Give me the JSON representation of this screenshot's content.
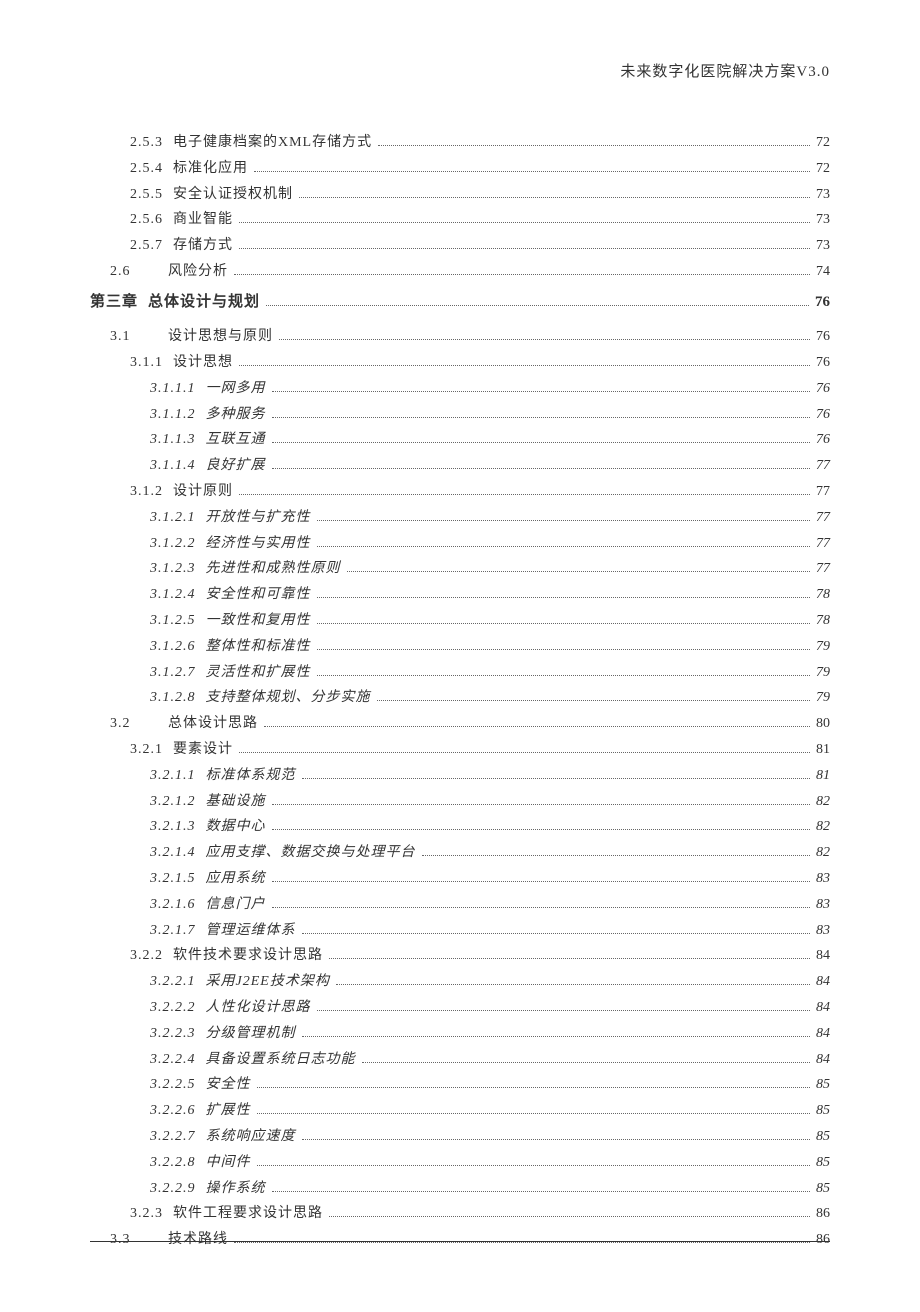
{
  "header": "未来数字化医院解决方案V3.0",
  "entries": [
    {
      "num": "2.5.3",
      "text": "电子健康档案的XML存储方式",
      "page": "72",
      "indent": 2
    },
    {
      "num": "2.5.4",
      "text": "标准化应用",
      "page": "72",
      "indent": 2
    },
    {
      "num": "2.5.5",
      "text": "安全认证授权机制",
      "page": "73",
      "indent": 2
    },
    {
      "num": "2.5.6",
      "text": "商业智能",
      "page": "73",
      "indent": 2
    },
    {
      "num": "2.5.7",
      "text": "存储方式",
      "page": "73",
      "indent": 2
    },
    {
      "num": "2.6",
      "text": "风险分析",
      "page": "74",
      "indent": 1,
      "wide": true
    },
    {
      "num": "第三章",
      "text": "总体设计与规划",
      "page": "76",
      "indent": 0,
      "chapter": true
    },
    {
      "num": "3.1",
      "text": "设计思想与原则",
      "page": "76",
      "indent": 1,
      "wide": true
    },
    {
      "num": "3.1.1",
      "text": "设计思想",
      "page": "76",
      "indent": 2
    },
    {
      "num": "3.1.1.1",
      "text": "一网多用",
      "page": "76",
      "indent": 3
    },
    {
      "num": "3.1.1.2",
      "text": "多种服务",
      "page": "76",
      "indent": 3
    },
    {
      "num": "3.1.1.3",
      "text": "互联互通",
      "page": "76",
      "indent": 3
    },
    {
      "num": "3.1.1.4",
      "text": "良好扩展",
      "page": "77",
      "indent": 3
    },
    {
      "num": "3.1.2",
      "text": "设计原则",
      "page": "77",
      "indent": 2
    },
    {
      "num": "3.1.2.1",
      "text": "开放性与扩充性",
      "page": "77",
      "indent": 3
    },
    {
      "num": "3.1.2.2",
      "text": "经济性与实用性",
      "page": "77",
      "indent": 3
    },
    {
      "num": "3.1.2.3",
      "text": "先进性和成熟性原则",
      "page": "77",
      "indent": 3
    },
    {
      "num": "3.1.2.4",
      "text": "安全性和可靠性",
      "page": "78",
      "indent": 3
    },
    {
      "num": "3.1.2.5",
      "text": "一致性和复用性",
      "page": "78",
      "indent": 3
    },
    {
      "num": "3.1.2.6",
      "text": "整体性和标准性",
      "page": "79",
      "indent": 3
    },
    {
      "num": "3.1.2.7",
      "text": "灵活性和扩展性",
      "page": "79",
      "indent": 3
    },
    {
      "num": "3.1.2.8",
      "text": "支持整体规划、分步实施",
      "page": "79",
      "indent": 3
    },
    {
      "num": "3.2",
      "text": "总体设计思路",
      "page": "80",
      "indent": 1,
      "wide": true
    },
    {
      "num": "3.2.1",
      "text": "要素设计",
      "page": "81",
      "indent": 2
    },
    {
      "num": "3.2.1.1",
      "text": "标准体系规范",
      "page": "81",
      "indent": 3
    },
    {
      "num": "3.2.1.2",
      "text": "基础设施",
      "page": "82",
      "indent": 3
    },
    {
      "num": "3.2.1.3",
      "text": "数据中心",
      "page": "82",
      "indent": 3
    },
    {
      "num": "3.2.1.4",
      "text": "应用支撑、数据交换与处理平台",
      "page": "82",
      "indent": 3
    },
    {
      "num": "3.2.1.5",
      "text": "应用系统",
      "page": "83",
      "indent": 3
    },
    {
      "num": "3.2.1.6",
      "text": "信息门户",
      "page": "83",
      "indent": 3
    },
    {
      "num": "3.2.1.7",
      "text": "管理运维体系",
      "page": "83",
      "indent": 3
    },
    {
      "num": "3.2.2",
      "text": "软件技术要求设计思路",
      "page": "84",
      "indent": 2
    },
    {
      "num": "3.2.2.1",
      "text": "采用J2EE技术架构",
      "page": "84",
      "indent": 3
    },
    {
      "num": "3.2.2.2",
      "text": "人性化设计思路",
      "page": "84",
      "indent": 3
    },
    {
      "num": "3.2.2.3",
      "text": "分级管理机制",
      "page": "84",
      "indent": 3
    },
    {
      "num": "3.2.2.4",
      "text": "具备设置系统日志功能",
      "page": "84",
      "indent": 3
    },
    {
      "num": "3.2.2.5",
      "text": "安全性",
      "page": "85",
      "indent": 3
    },
    {
      "num": "3.2.2.6",
      "text": "扩展性",
      "page": "85",
      "indent": 3
    },
    {
      "num": "3.2.2.7",
      "text": "系统响应速度",
      "page": "85",
      "indent": 3
    },
    {
      "num": "3.2.2.8",
      "text": "中间件",
      "page": "85",
      "indent": 3
    },
    {
      "num": "3.2.2.9",
      "text": "操作系统",
      "page": "85",
      "indent": 3
    },
    {
      "num": "3.2.3",
      "text": "软件工程要求设计思路",
      "page": "86",
      "indent": 2
    },
    {
      "num": "3.3",
      "text": "技术路线",
      "page": "86",
      "indent": 1,
      "wide": true
    }
  ]
}
